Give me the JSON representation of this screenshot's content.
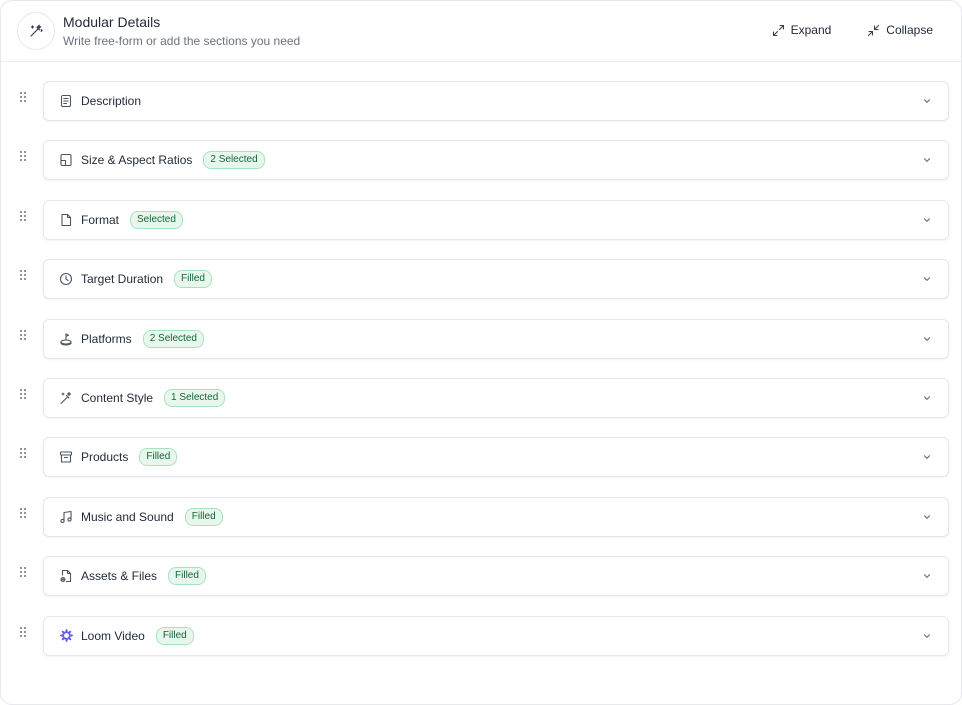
{
  "header": {
    "title": "Modular Details",
    "subtitle": "Write free-form or add the sections you need",
    "icon": "magic-wand-icon",
    "expand_label": "Expand",
    "collapse_label": "Collapse"
  },
  "colors": {
    "badge_text": "#166534",
    "badge_bg": "#e8f7ee",
    "badge_border": "#a7e3bf",
    "loom_accent": "#625df5"
  },
  "sections": [
    {
      "label": "Description",
      "badge": "",
      "icon": "document-text-icon"
    },
    {
      "label": "Size & Aspect Ratios",
      "badge": "2 Selected",
      "icon": "aspect-ratio-icon"
    },
    {
      "label": "Format",
      "badge": "Selected",
      "icon": "file-icon"
    },
    {
      "label": "Target Duration",
      "badge": "Filled",
      "icon": "clock-icon"
    },
    {
      "label": "Platforms",
      "badge": "2 Selected",
      "icon": "joystick-icon"
    },
    {
      "label": "Content Style",
      "badge": "1 Selected",
      "icon": "magic-wand-icon"
    },
    {
      "label": "Products",
      "badge": "Filled",
      "icon": "archive-box-icon"
    },
    {
      "label": "Music and Sound",
      "badge": "Filled",
      "icon": "music-note-icon"
    },
    {
      "label": "Assets & Files",
      "badge": "Filled",
      "icon": "file-attachment-icon"
    },
    {
      "label": "Loom Video",
      "badge": "Filled",
      "icon": "loom-logo-icon"
    }
  ]
}
